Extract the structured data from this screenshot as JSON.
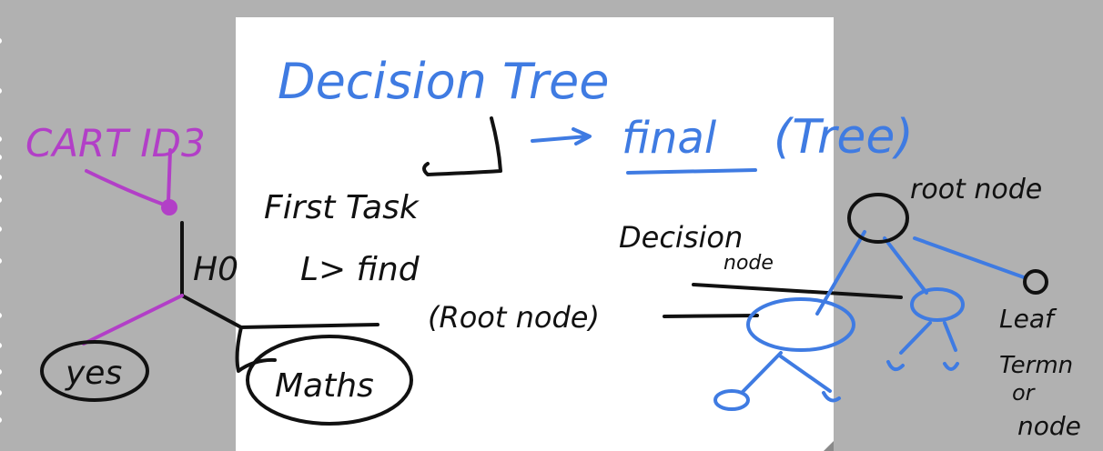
{
  "colors": {
    "background": "#b1b1b1",
    "page": "#ffffff",
    "ink_blue": "#3f7be2",
    "ink_black": "#111111",
    "ink_purple": "#b23fc7"
  },
  "texts": {
    "title": "Decision Tree",
    "final": "final",
    "tree_paren": "(Tree)",
    "first_task": "First Task",
    "find": "L> find",
    "root_node": "(Root node)",
    "decision_node_1": "Decision",
    "decision_node_2": "node",
    "root_node_label": "root node",
    "leaf_1": "Leaf",
    "leaf_2": "Termn",
    "leaf_3": "or",
    "leaf_4": "node",
    "algos": "CART ID3",
    "h0": "H0",
    "yes": "yes",
    "maths": "Maths"
  }
}
